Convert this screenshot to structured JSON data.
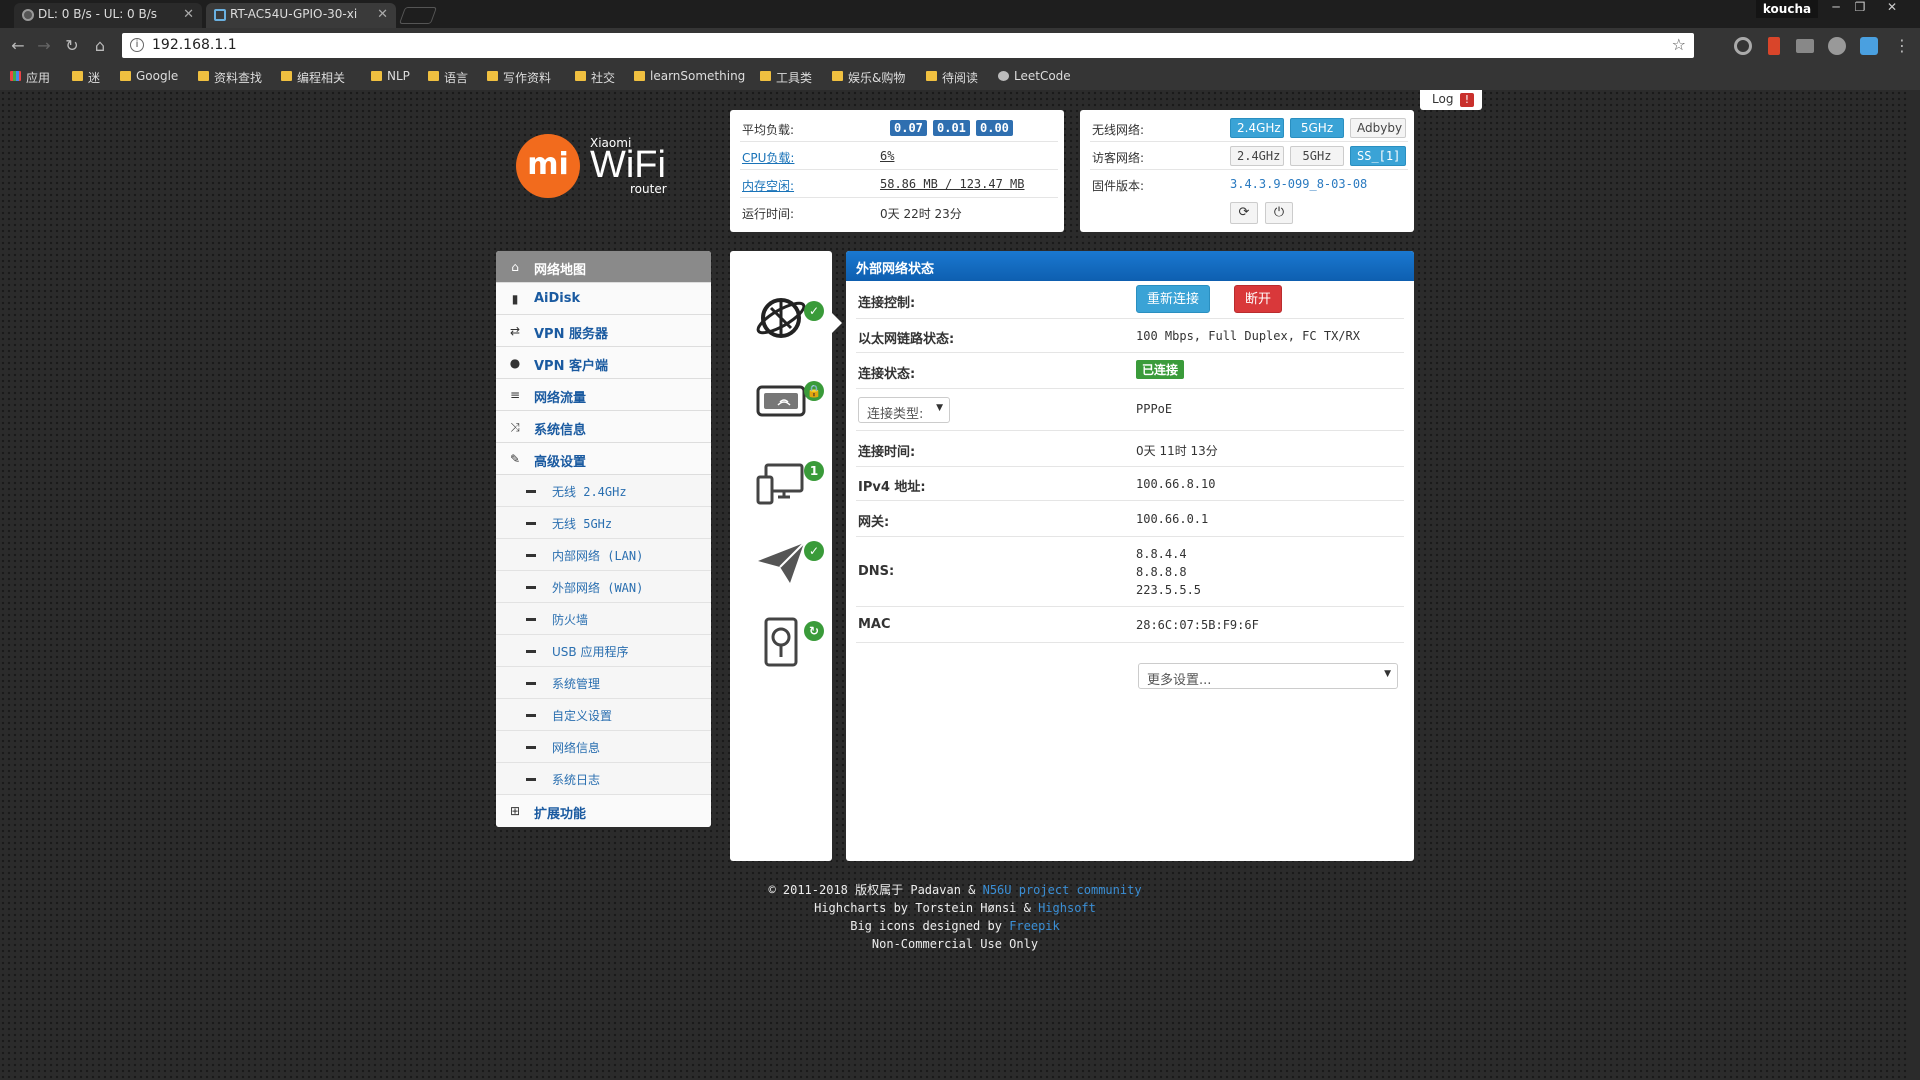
{
  "browser": {
    "tabs": [
      {
        "title": "DL: 0 B/s - UL: 0 B/s"
      },
      {
        "title": "RT-AC54U-GPIO-30-xi"
      }
    ],
    "profile": "koucha",
    "url": "192.168.1.1",
    "bookmarks": [
      "应用",
      "迷",
      "Google",
      "资料查找",
      "编程相关",
      "NLP",
      "语言",
      "写作资料",
      "社交",
      "learnSomething",
      "工具类",
      "娱乐&购物",
      "待阅读",
      "LeetCode"
    ]
  },
  "log": {
    "label": "Log",
    "badge": "!"
  },
  "logo": {
    "brand": "mi",
    "xiaomi": "Xiaomi",
    "wifi": "WiFi",
    "router": "router"
  },
  "stats": {
    "load_label": "平均负载:",
    "load_values": [
      "0.07",
      "0.01",
      "0.00"
    ],
    "cpu_label": "CPU负载:",
    "cpu_value": "6%",
    "mem_label": "内存空闲:",
    "mem_value": "58.86 MB / 123.47 MB",
    "uptime_label": "运行时间:",
    "uptime_value": "0天 22时 23分"
  },
  "wireless": {
    "wifi_label": "无线网络:",
    "wifi_buttons": [
      "2.4GHz",
      "5GHz",
      "Adbyby"
    ],
    "guest_label": "访客网络:",
    "guest_buttons": [
      "2.4GHz",
      "5GHz",
      "SS_[1]"
    ],
    "firmware_label": "固件版本:",
    "firmware_value": "3.4.3.9-099_8-03-08"
  },
  "sidebar": {
    "items": [
      {
        "label": "网络地图",
        "icon": "home-icon"
      },
      {
        "label": "AiDisk",
        "icon": "disk-icon"
      },
      {
        "label": "VPN 服务器",
        "icon": "retweet-icon"
      },
      {
        "label": "VPN 客户端",
        "icon": "globe-icon"
      },
      {
        "label": "网络流量",
        "icon": "list-icon"
      },
      {
        "label": "系统信息",
        "icon": "shuffle-icon"
      },
      {
        "label": "高级设置",
        "icon": "wrench-icon"
      }
    ],
    "subitems": [
      "无线 2.4GHz",
      "无线 5GHz",
      "内部网络 (LAN)",
      "外部网络 (WAN)",
      "防火墙",
      "USB 应用程序",
      "系统管理",
      "自定义设置",
      "网络信息",
      "系统日志"
    ],
    "extension": {
      "label": "扩展功能",
      "icon": "grid-icon"
    }
  },
  "status_icons": [
    "internet-globe-icon",
    "router-lock-icon",
    "clients-icon",
    "paper-plane-icon",
    "usb-disk-icon"
  ],
  "status_badges": [
    "✓",
    "🔒",
    "1",
    "✓",
    "↻"
  ],
  "wan": {
    "header": "外部网络状态",
    "control_label": "连接控制:",
    "reconnect": "重新连接",
    "disconnect": "断开",
    "link_label": "以太网链路状态:",
    "link_value": "100 Mbps, Full Duplex, FC TX/RX",
    "state_label": "连接状态:",
    "state_value": "已连接",
    "type_select": "连接类型:",
    "type_value": "PPPoE",
    "time_label": "连接时间:",
    "time_value": "0天 11时 13分",
    "ipv4_label": "IPv4 地址:",
    "ipv4_value": "100.66.8.10",
    "gw_label": "网关:",
    "gw_value": "100.66.0.1",
    "dns_label": "DNS:",
    "dns_values": [
      "8.8.4.4",
      "8.8.8.8",
      "223.5.5.5"
    ],
    "mac_label": "MAC",
    "mac_value": "28:6C:07:5B:F9:6F",
    "more_select": "更多设置..."
  },
  "footer": {
    "line1_prefix": "© 2011-2018 版权属于 Padavan & ",
    "line1_link": "N56U project community",
    "line2_prefix": "Highcharts by Torstein Hønsi & ",
    "line2_link": "Highsoft",
    "line3_prefix": "Big icons designed by ",
    "line3_link": "Freepik",
    "line4": "Non-Commercial Use Only"
  },
  "colors": {
    "accent": "#3aa3d6",
    "header_blue": "#1a78d0",
    "danger": "#d9383a",
    "success": "#3a9b3a",
    "mi_orange": "#f26b1d"
  }
}
